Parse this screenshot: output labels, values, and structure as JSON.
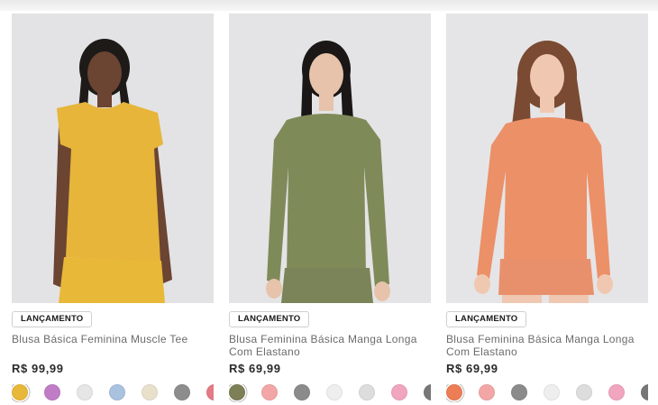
{
  "products": [
    {
      "badge": "LANÇAMENTO",
      "name": "Blusa Básica Feminina Muscle Tee",
      "price": "R$ 99,99",
      "garment_color": "#e6b53a",
      "swatches": [
        "#e8b83a",
        "#c07cc4",
        "#e6e6e6",
        "#a9c2e0",
        "#e9e0cc",
        "#8d8d8d",
        "#e57a86"
      ]
    },
    {
      "badge": "LANÇAMENTO",
      "name": "Blusa Feminina Básica Manga Longa Com Elastano",
      "price": "R$ 69,99",
      "garment_color": "#7f8a59",
      "swatches": [
        "#7d8057",
        "#f2a7a6",
        "#8b8b8b",
        "#eeeeee",
        "#dddddd",
        "#f1a5be",
        "#777777"
      ]
    },
    {
      "badge": "LANÇAMENTO",
      "name": "Blusa Feminina Básica Manga Longa Com Elastano",
      "price": "R$ 69,99",
      "garment_color": "#ec9068",
      "swatches": [
        "#ec7d55",
        "#f2a7a6",
        "#8b8b8b",
        "#eeeeee",
        "#dddddd",
        "#f1a5be",
        "#777777"
      ]
    }
  ]
}
